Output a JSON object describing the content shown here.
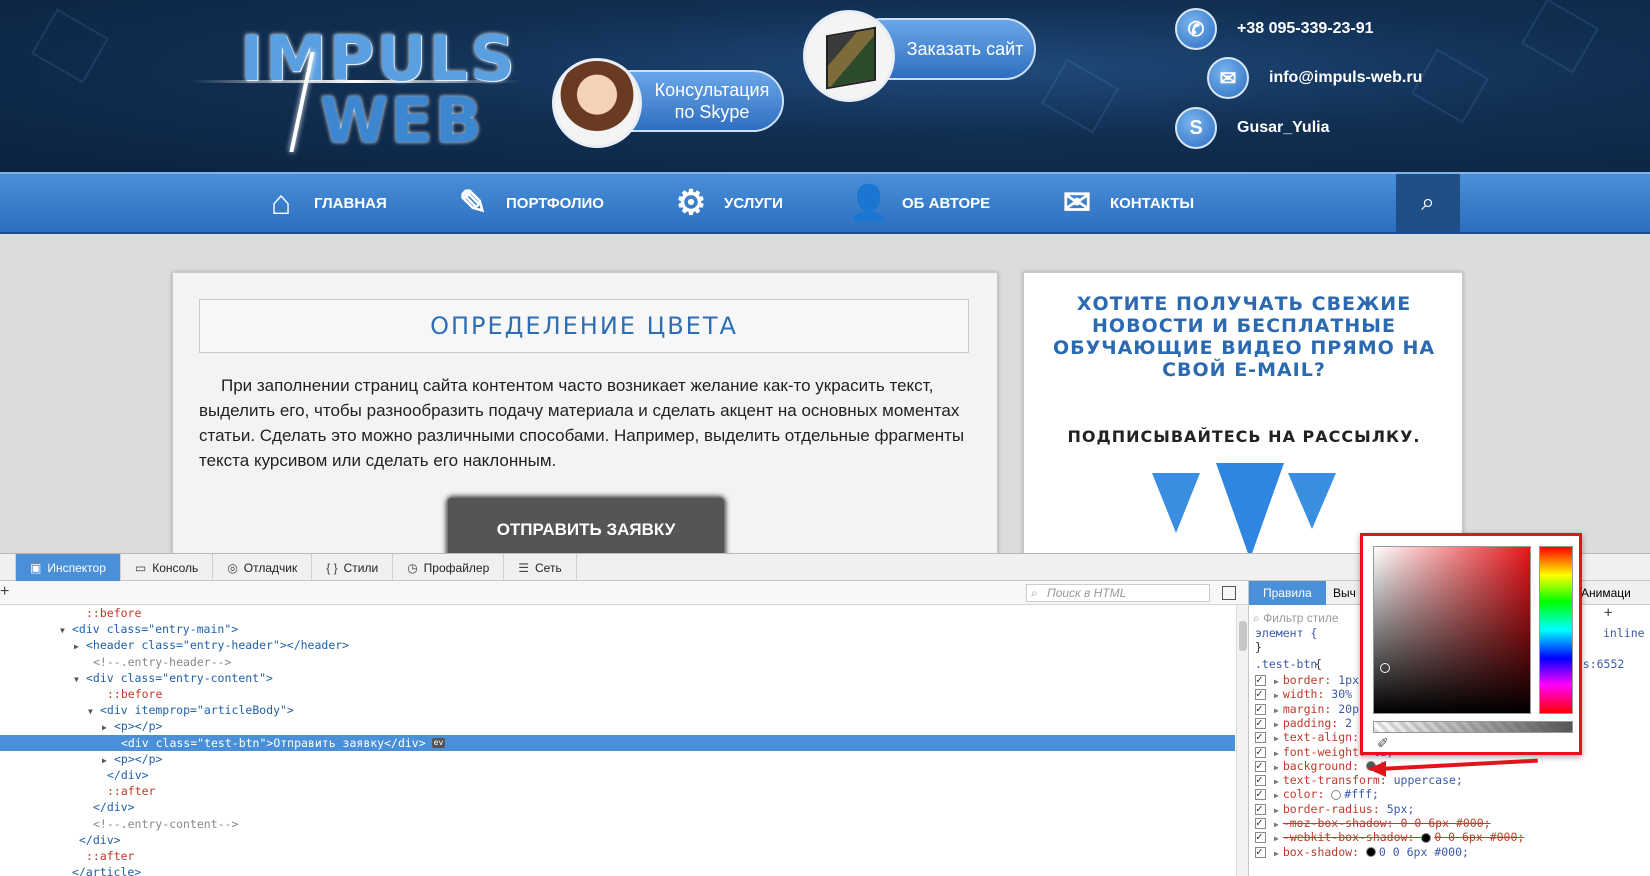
{
  "header": {
    "logo_line1": "IMPULS",
    "logo_line2": "WEB",
    "skype_consult": "Консультация по Skype",
    "order_site": "Заказать сайт",
    "phone": "+38 095-339-23-91",
    "email": "info@impuls-web.ru",
    "skype_user": "Gusar_Yulia"
  },
  "nav": {
    "items": [
      {
        "label": "ГЛАВНАЯ",
        "icon": "home-icon"
      },
      {
        "label": "ПОРТФОЛИО",
        "icon": "notepad-icon"
      },
      {
        "label": "УСЛУГИ",
        "icon": "gear-icon"
      },
      {
        "label": "ОБ АВТОРЕ",
        "icon": "user-icon"
      },
      {
        "label": "КОНТАКТЫ",
        "icon": "contacts-icon"
      }
    ],
    "search_icon": "search-icon"
  },
  "article": {
    "title": "ОПРЕДЕЛЕНИЕ ЦВЕТА",
    "text": "При заполнении страниц сайта контентом часто возникает желание как-то украсить текст, выделить его, чтобы разнообразить подачу материала и сделать акцент на основных моментах статьи. Сделать это можно различными способами. Например, выделить отдельные фрагменты текста курсивом или сделать его наклонным.",
    "button": "ОТПРАВИТЬ ЗАЯВКУ"
  },
  "sidebar": {
    "promo_title": "ХОТИТЕ ПОЛУЧАТЬ СВЕЖИЕ НОВОСТИ И БЕСПЛАТНЫЕ ОБУЧАЮЩИЕ ВИДЕО ПРЯМО НА СВОЙ E-MAIL?",
    "promo_sub": "ПОДПИСЫВАЙТЕСЬ НА РАССЫЛКУ."
  },
  "devtools": {
    "tabs": [
      {
        "label": "Инспектор",
        "icon": "inspector-icon"
      },
      {
        "label": "Консоль",
        "icon": "console-icon"
      },
      {
        "label": "Отладчик",
        "icon": "debugger-icon"
      },
      {
        "label": "Стили",
        "icon": "braces-icon"
      },
      {
        "label": "Профайлер",
        "icon": "profiler-icon"
      },
      {
        "label": "Сеть",
        "icon": "network-icon"
      }
    ],
    "html_search_placeholder": "Поиск в HTML",
    "dom_lines": [
      {
        "indent": 12,
        "text": "::before",
        "kind": "pseudo",
        "twisty": ""
      },
      {
        "indent": 10,
        "text": "<div class=\"entry-main\">",
        "kind": "tag",
        "twisty": "open"
      },
      {
        "indent": 12,
        "text": "<header class=\"entry-header\"></header>",
        "kind": "tag",
        "twisty": "closed"
      },
      {
        "indent": 13,
        "text": "<!--.entry-header-->",
        "kind": "cmt",
        "twisty": ""
      },
      {
        "indent": 12,
        "text": "<div class=\"entry-content\">",
        "kind": "tag",
        "twisty": "open"
      },
      {
        "indent": 15,
        "text": "::before",
        "kind": "pseudo",
        "twisty": ""
      },
      {
        "indent": 14,
        "text": "<div itemprop=\"articleBody\">",
        "kind": "tag",
        "twisty": "open"
      },
      {
        "indent": 16,
        "text": "<p></p>",
        "kind": "tag",
        "twisty": "closed"
      },
      {
        "indent": 17,
        "text": "<div class=\"test-btn\">Отправить заявку</div>",
        "kind": "tag",
        "twisty": "",
        "selected": true,
        "badge": "ev"
      },
      {
        "indent": 16,
        "text": "<p></p>",
        "kind": "tag",
        "twisty": "closed"
      },
      {
        "indent": 15,
        "text": "</div>",
        "kind": "tag",
        "twisty": ""
      },
      {
        "indent": 15,
        "text": "::after",
        "kind": "pseudo",
        "twisty": ""
      },
      {
        "indent": 13,
        "text": "</div>",
        "kind": "tag",
        "twisty": ""
      },
      {
        "indent": 13,
        "text": "<!--.entry-content-->",
        "kind": "cmt",
        "twisty": ""
      },
      {
        "indent": 11,
        "text": "</div>",
        "kind": "tag",
        "twisty": ""
      },
      {
        "indent": 12,
        "text": "::after",
        "kind": "pseudo",
        "twisty": ""
      },
      {
        "indent": 10,
        "text": "</article>",
        "kind": "tag",
        "twisty": ""
      }
    ],
    "rules_tabs": [
      "Правила",
      "Выч",
      "Анимаци"
    ],
    "filter_placeholder": "Фильтр стиле",
    "element_rule": "элемент {",
    "element_close": "}",
    "element_display": "inline",
    "selector": ".test-btn",
    "source": ".css:6552",
    "props": [
      {
        "name": "border",
        "value": "1px",
        "strike": false
      },
      {
        "name": "width",
        "value": "30%",
        "strike": false
      },
      {
        "name": "margin",
        "value": "20p",
        "strike": false
      },
      {
        "name": "padding",
        "value": "2",
        "strike": false
      },
      {
        "name": "text-align",
        "value": "",
        "strike": false
      },
      {
        "name": "font-weight",
        "value": "ld;",
        "strike": false
      },
      {
        "name": "background",
        "value": "#",
        "strike": false,
        "swatch": "#555555"
      },
      {
        "name": "text-transform",
        "value": "uppercase;",
        "strike": false
      },
      {
        "name": "color",
        "value": "#fff;",
        "strike": false,
        "swatch": "#ffffff"
      },
      {
        "name": "border-radius",
        "value": "5px;",
        "strike": false
      },
      {
        "name": "-moz-box-shadow",
        "value": "0 0 6px #000;",
        "strike": true
      },
      {
        "name": "-webkit-box-shadow",
        "value": "0 0 6px #000;",
        "strike": true,
        "swatch": "#000000"
      },
      {
        "name": "box-shadow",
        "value": "0 0 6px #000;",
        "strike": false,
        "swatch": "#000000"
      }
    ]
  },
  "colors": {
    "nav_blue": "#2c6fc0",
    "accent_red": "#e0151b",
    "selection_blue": "#4a90d9",
    "button_gray": "#555555"
  }
}
